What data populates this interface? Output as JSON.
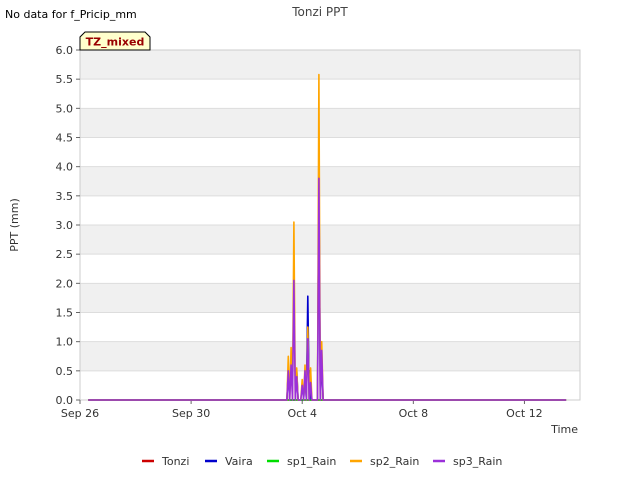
{
  "header_note": "No data for f_Pricip_mm",
  "badge": "TZ_mixed",
  "chart_data": {
    "type": "line",
    "title": "Tonzi PPT",
    "xlabel": "Time",
    "ylabel": "PPT (mm)",
    "ylim": [
      0,
      6.0
    ],
    "xlim_days": [
      0,
      18
    ],
    "y_ticks": [
      "0.0",
      "0.5",
      "1.0",
      "1.5",
      "2.0",
      "2.5",
      "3.0",
      "3.5",
      "4.0",
      "4.5",
      "5.0",
      "5.5",
      "6.0"
    ],
    "x_ticks": [
      {
        "day": 0,
        "label": "Sep 26"
      },
      {
        "day": 4,
        "label": "Sep 30"
      },
      {
        "day": 8,
        "label": "Oct 4"
      },
      {
        "day": 12,
        "label": "Oct 8"
      },
      {
        "day": 16,
        "label": "Oct 12"
      }
    ],
    "grid": "horizontal bands",
    "legend_position": "bottom",
    "series": [
      {
        "name": "Tonzi",
        "color": "#cc0000",
        "points": [
          [
            0.3,
            0
          ],
          [
            17.5,
            0
          ]
        ]
      },
      {
        "name": "Vaira",
        "color": "#0000cc",
        "points": [
          [
            0.3,
            0
          ],
          [
            7.45,
            0
          ],
          [
            7.5,
            0.5
          ],
          [
            7.55,
            0
          ],
          [
            7.75,
            0
          ],
          [
            7.8,
            0.5
          ],
          [
            7.85,
            0
          ],
          [
            8.05,
            0
          ],
          [
            8.1,
            0.45
          ],
          [
            8.15,
            0
          ],
          [
            8.2,
            1.78
          ],
          [
            8.25,
            0
          ],
          [
            8.28,
            0.5
          ],
          [
            8.32,
            0
          ],
          [
            8.55,
            0
          ],
          [
            8.6,
            3.8
          ],
          [
            8.65,
            0
          ],
          [
            8.7,
            0.7
          ],
          [
            8.75,
            0
          ],
          [
            17.5,
            0
          ]
        ]
      },
      {
        "name": "sp1_Rain",
        "color": "#00dd00",
        "points": [
          [
            0.3,
            0
          ],
          [
            17.5,
            0
          ]
        ]
      },
      {
        "name": "sp2_Rain",
        "color": "#ffa500",
        "points": [
          [
            0.3,
            0
          ],
          [
            7.45,
            0
          ],
          [
            7.5,
            0.75
          ],
          [
            7.55,
            0
          ],
          [
            7.6,
            0.9
          ],
          [
            7.65,
            0
          ],
          [
            7.7,
            3.05
          ],
          [
            7.75,
            0
          ],
          [
            7.8,
            0.55
          ],
          [
            7.85,
            0
          ],
          [
            7.95,
            0
          ],
          [
            8.0,
            0.35
          ],
          [
            8.05,
            0
          ],
          [
            8.1,
            0.6
          ],
          [
            8.15,
            0
          ],
          [
            8.2,
            1.25
          ],
          [
            8.25,
            0
          ],
          [
            8.3,
            0.55
          ],
          [
            8.35,
            0
          ],
          [
            8.55,
            0
          ],
          [
            8.6,
            5.58
          ],
          [
            8.65,
            0
          ],
          [
            8.7,
            1.0
          ],
          [
            8.75,
            0
          ],
          [
            17.5,
            0
          ]
        ]
      },
      {
        "name": "sp3_Rain",
        "color": "#9b30d9",
        "points": [
          [
            0.3,
            0
          ],
          [
            7.45,
            0
          ],
          [
            7.5,
            0.5
          ],
          [
            7.55,
            0
          ],
          [
            7.6,
            0.6
          ],
          [
            7.65,
            0
          ],
          [
            7.7,
            2.05
          ],
          [
            7.75,
            0
          ],
          [
            7.8,
            0.4
          ],
          [
            7.85,
            0
          ],
          [
            7.95,
            0
          ],
          [
            8.0,
            0.25
          ],
          [
            8.05,
            0
          ],
          [
            8.1,
            0.5
          ],
          [
            8.15,
            0
          ],
          [
            8.2,
            1.05
          ],
          [
            8.25,
            0
          ],
          [
            8.3,
            0.3
          ],
          [
            8.35,
            0
          ],
          [
            8.55,
            0
          ],
          [
            8.6,
            3.8
          ],
          [
            8.65,
            0
          ],
          [
            8.7,
            0.85
          ],
          [
            8.75,
            0
          ],
          [
            17.5,
            0
          ]
        ]
      }
    ]
  },
  "colors": {
    "band": "#f0f0f0",
    "grid": "#dddddd",
    "badge_bg": "#ffffcc",
    "badge_text": "#990000"
  }
}
